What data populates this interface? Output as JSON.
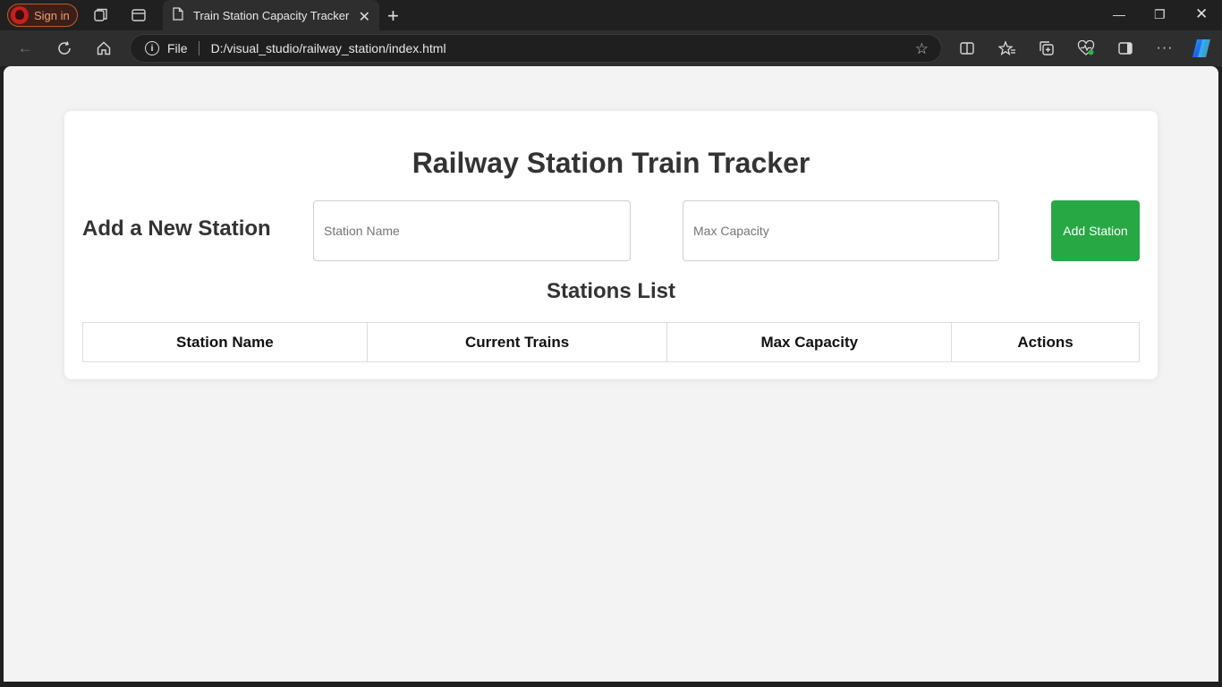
{
  "browser": {
    "signin_label": "Sign in",
    "tab_title": "Train Station Capacity Tracker",
    "address_scheme": "File",
    "address_url": "D:/visual_studio/railway_station/index.html"
  },
  "page": {
    "title": "Railway Station Train Tracker",
    "add_section_label": "Add a New Station",
    "station_name_placeholder": "Station Name",
    "max_capacity_placeholder": "Max Capacity",
    "add_button_label": "Add Station",
    "list_title": "Stations List",
    "table_headers": [
      "Station Name",
      "Current Trains",
      "Max Capacity",
      "Actions"
    ],
    "rows": []
  },
  "colors": {
    "accent_button": "#28a745",
    "page_bg": "#f3f3f3",
    "chrome_bg": "#202020"
  }
}
